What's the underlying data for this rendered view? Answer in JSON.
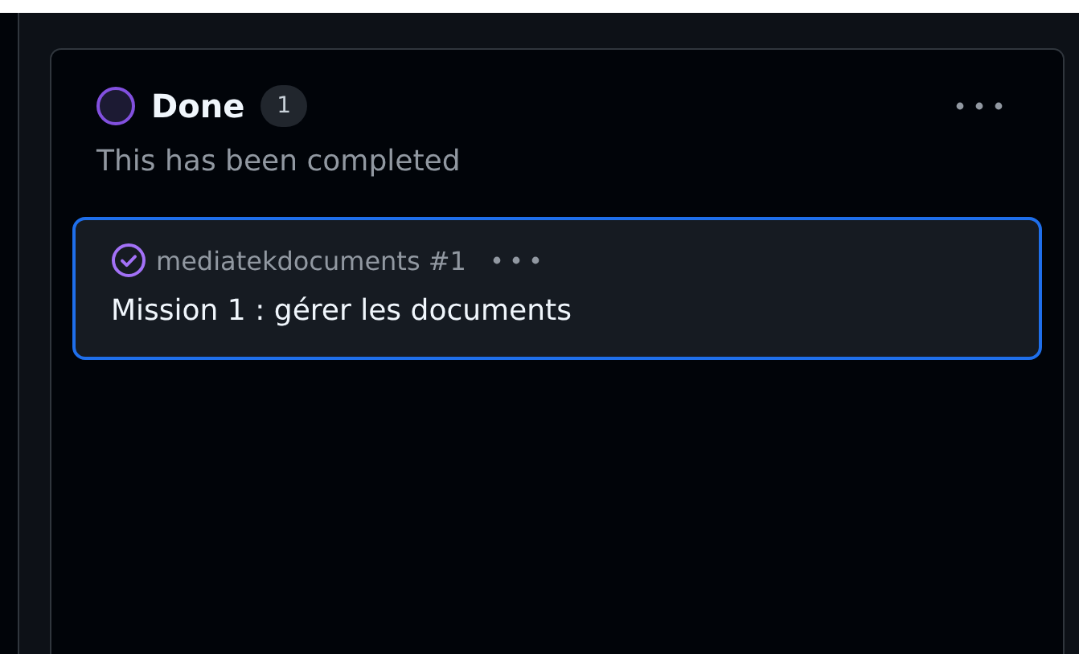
{
  "column": {
    "name": "Done",
    "count": "1",
    "description": "This has been completed",
    "cards": [
      {
        "selected": true,
        "reference": "mediatekdocuments #1",
        "title": "Mission 1 : gérer les documents"
      }
    ]
  }
}
